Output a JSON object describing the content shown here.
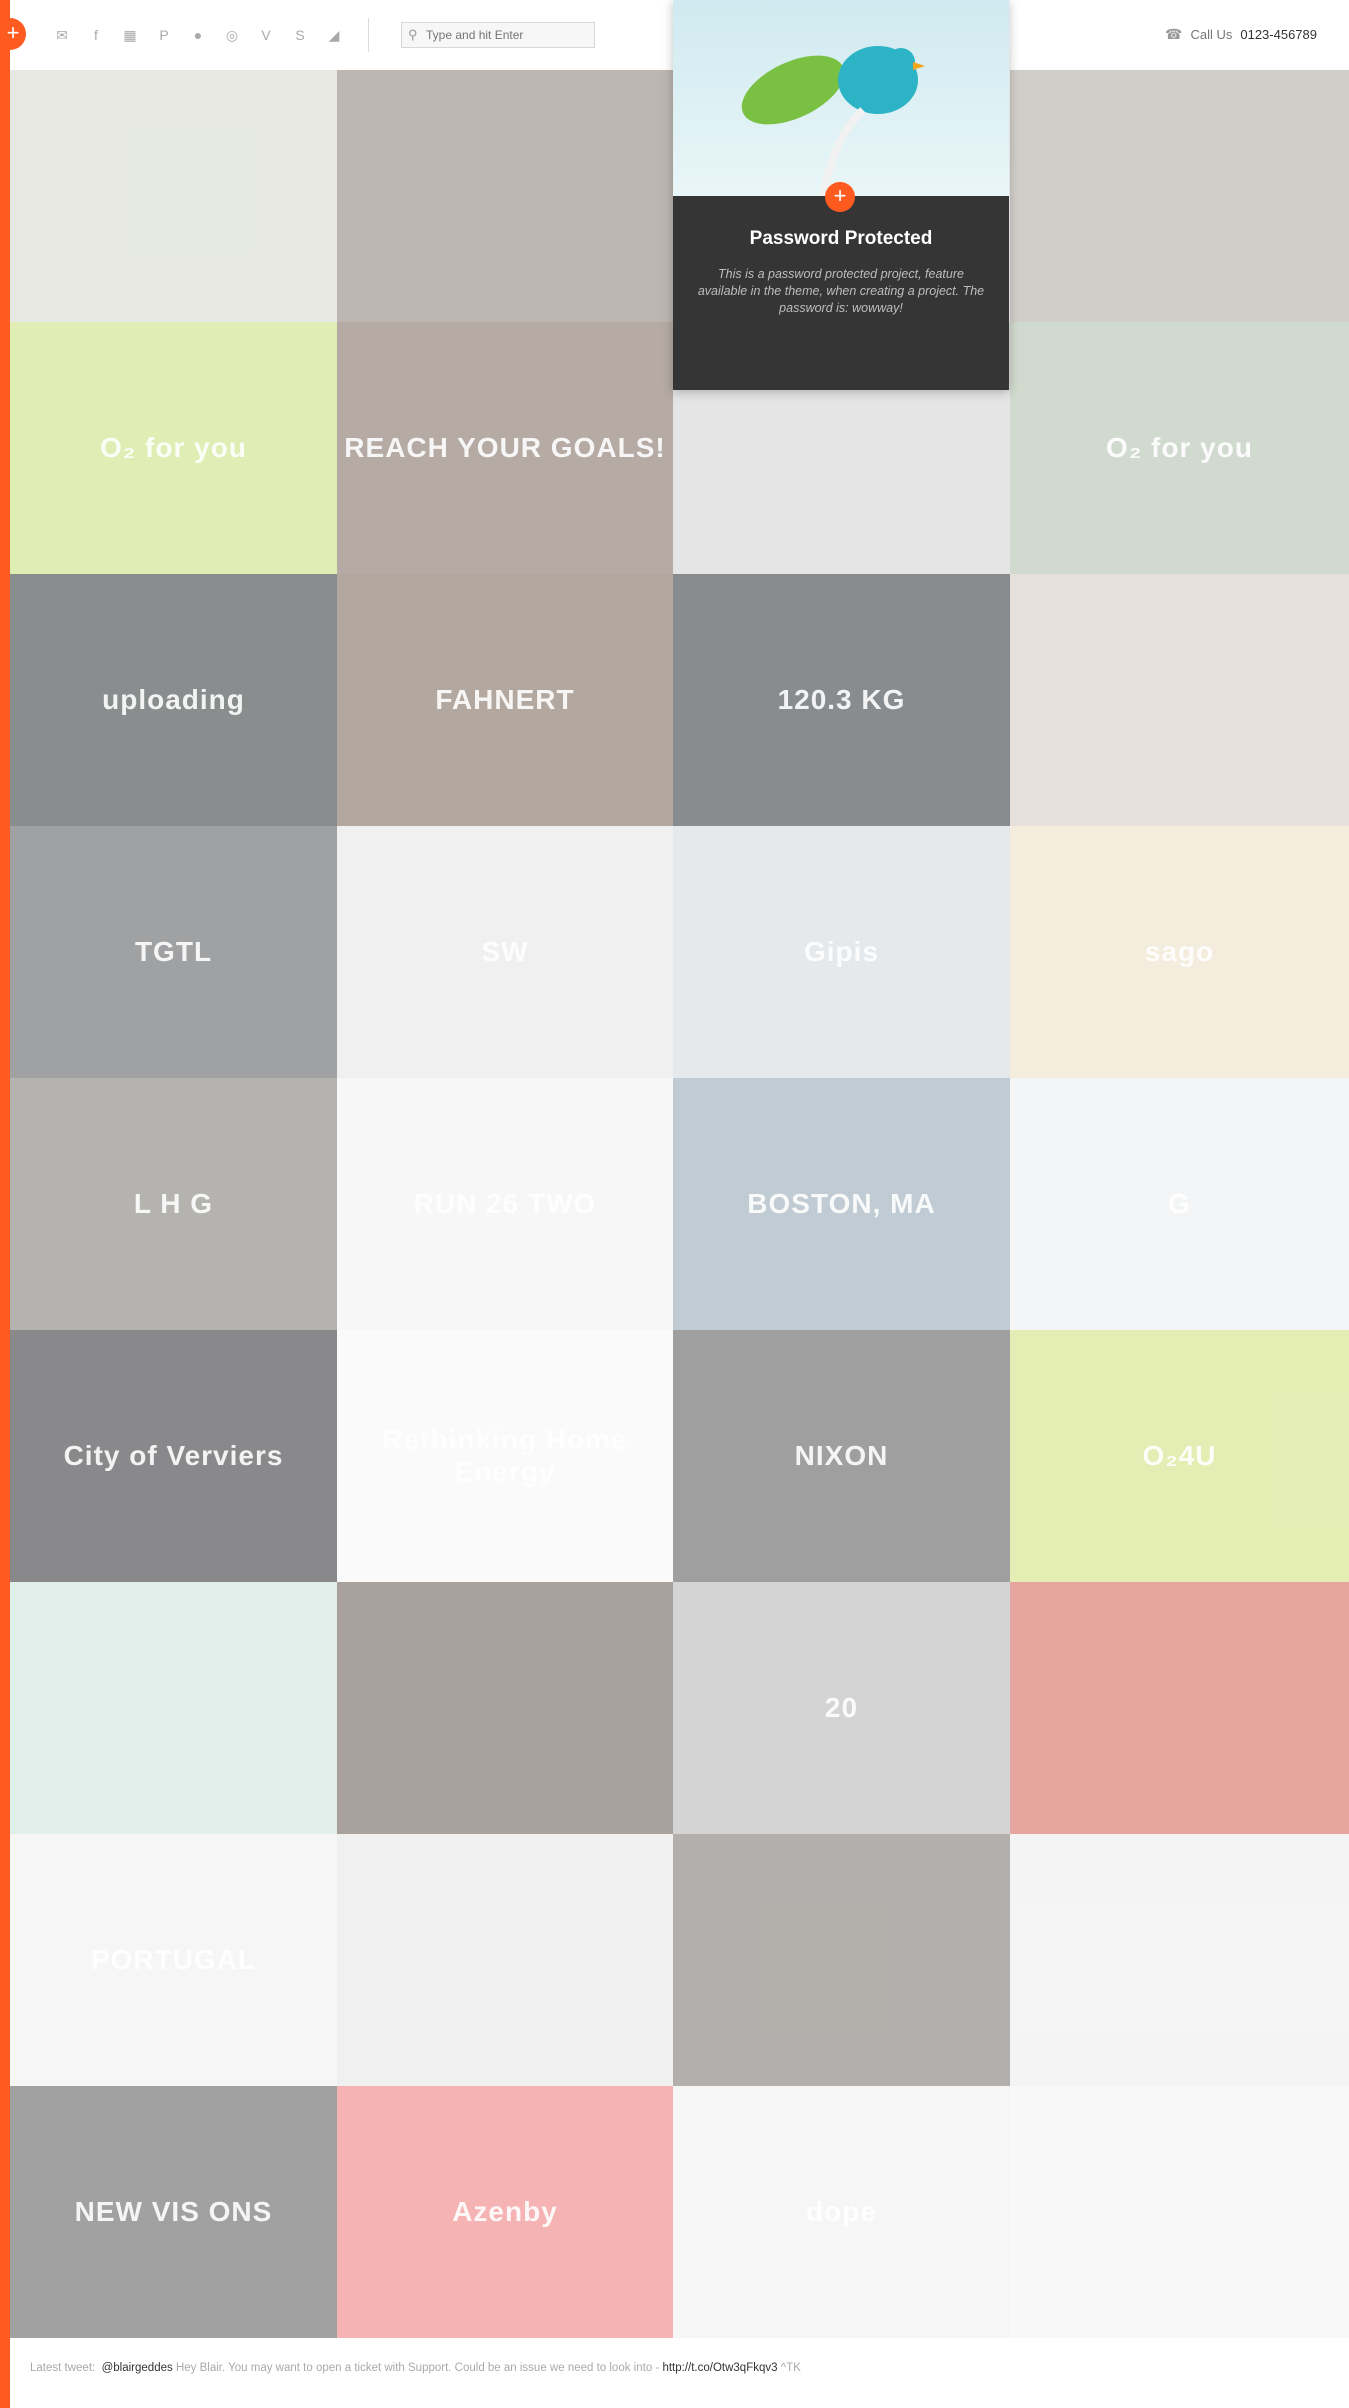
{
  "header": {
    "social": [
      {
        "name": "twitter-icon",
        "glyph": "✉"
      },
      {
        "name": "facebook-icon",
        "glyph": "f"
      },
      {
        "name": "calendar-icon",
        "glyph": "▦"
      },
      {
        "name": "pinterest-icon",
        "glyph": "P"
      },
      {
        "name": "flickr-icon",
        "glyph": "●"
      },
      {
        "name": "dribbble-icon",
        "glyph": "◎"
      },
      {
        "name": "vimeo-icon",
        "glyph": "V"
      },
      {
        "name": "skype-icon",
        "glyph": "S"
      },
      {
        "name": "rss-icon",
        "glyph": "◢"
      }
    ],
    "search_placeholder": "Type and hit Enter",
    "call_label": "Call Us",
    "phone": "0123-456789",
    "menu_glyph": "+"
  },
  "feature": {
    "title": "Password Protected",
    "text": "This is a password protected project, feature available in the theme, when creating a project. The password is: wowway!",
    "plus": "+"
  },
  "tiles": [
    {
      "text": "",
      "bg": "#d9dcd2"
    },
    {
      "text": "",
      "bg": "#9a8f86"
    },
    {
      "text": "",
      "bg": "#ffffff"
    },
    {
      "text": "",
      "bg": "#b8b4ad"
    },
    {
      "text": "O₂ for you",
      "bg": "#cfe48c"
    },
    {
      "text": "REACH YOUR GOALS!",
      "bg": "#8e7f74"
    },
    {
      "text": "",
      "bg": "#d8d8d8"
    },
    {
      "text": "O₂ for you",
      "bg": "#b9c6b4"
    },
    {
      "text": "uploading",
      "bg": "#4c5052"
    },
    {
      "text": "FAHNERT",
      "bg": "#8a7a6c"
    },
    {
      "text": "120.3 KG",
      "bg": "#4a4f53"
    },
    {
      "text": "",
      "bg": "#d8cfc8"
    },
    {
      "text": "TGTL",
      "bg": "#6d6f72"
    },
    {
      "text": "SW",
      "bg": "#e8e8e8"
    },
    {
      "text": "Gipis",
      "bg": "#d9dde0"
    },
    {
      "text": "sago",
      "bg": "#efe3cc"
    },
    {
      "text": "L H G",
      "bg": "#8c8a86"
    },
    {
      "text": "RUN 26 TWO",
      "bg": "#f3f3f3"
    },
    {
      "text": "BOSTON, MA",
      "bg": "#9fb0bd"
    },
    {
      "text": "G",
      "bg": "#eef0f1"
    },
    {
      "text": "City of Verviers",
      "bg": "#4a4b4e"
    },
    {
      "text": "Rethinking Home Energy",
      "bg": "#f7f7f7"
    },
    {
      "text": "NIXON",
      "bg": "#6c6c6c"
    },
    {
      "text": "O₂4U",
      "bg": "#d5e38d"
    },
    {
      "text": "",
      "bg": "#cfe6df"
    },
    {
      "text": "",
      "bg": "#7a6f66"
    },
    {
      "text": "20",
      "bg": "#bebebe"
    },
    {
      "text": "",
      "bg": "#d9766c"
    },
    {
      "text": "PORTUGAL",
      "bg": "#f2f2f2"
    },
    {
      "text": "",
      "bg": "#e8e8e8"
    },
    {
      "text": "",
      "bg": "#8a8580"
    },
    {
      "text": "",
      "bg": "#efefef"
    },
    {
      "text": "NEW VIS ONS",
      "bg": "#6f6f6f"
    },
    {
      "text": "Azenby",
      "bg": "#f08a8a"
    },
    {
      "text": "dope",
      "bg": "#f2f2f2"
    },
    {
      "text": "",
      "bg": "#f4f4f4"
    }
  ],
  "footer": {
    "label": "Latest tweet:",
    "handle": "@blairgeddes",
    "text": "Hey Blair. You may want to open a ticket with Support. Could be an issue we need to look into -",
    "link": "http://t.co/Otw3qFkqv3",
    "suffix": "^TK"
  }
}
